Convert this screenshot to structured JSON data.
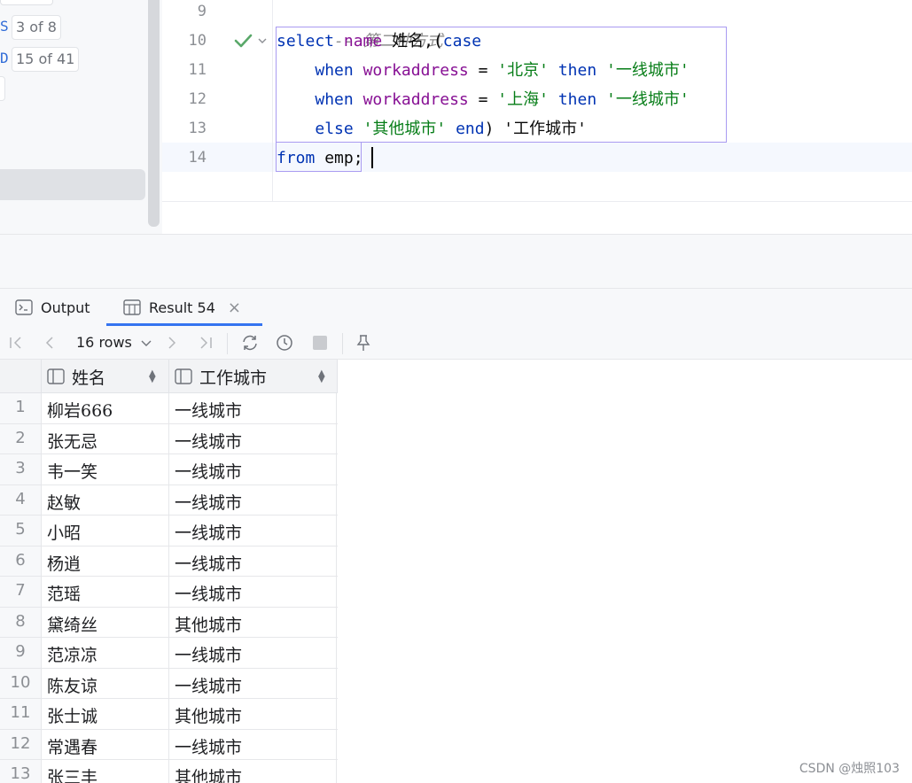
{
  "sidebar": {
    "badges": [
      "3 of 8",
      "15 of 41"
    ],
    "marks": [
      "S",
      "D"
    ]
  },
  "editor": {
    "line_numbers": [
      "9",
      "10",
      "11",
      "12",
      "13",
      "14"
    ],
    "comment": "-- 第二种方式",
    "l10": {
      "select": "select",
      "name": "name",
      "alias": "姓名,(",
      "case": "case"
    },
    "l11": {
      "indent": "    ",
      "when": "when",
      "col": "workaddress",
      "eq": " = ",
      "val": "'北京'",
      "then": "then",
      "res": "'一线城市'"
    },
    "l12": {
      "indent": "    ",
      "when": "when",
      "col": "workaddress",
      "eq": " = ",
      "val": "'上海'",
      "then": "then",
      "res": "'一线城市'"
    },
    "l13": {
      "indent": "    ",
      "else": "else",
      "val": "'其他城市'",
      "end": "end",
      "tail": ") '工作城市'"
    },
    "l14": {
      "from": "from",
      "table": " emp;"
    }
  },
  "tabs": {
    "output": "Output",
    "result": "Result 54",
    "close": "×"
  },
  "toolbar": {
    "rows": "16 rows",
    "rows_arrow": "⌄"
  },
  "grid": {
    "columns": [
      "姓名",
      "工作城市"
    ],
    "rows": [
      {
        "n": "1",
        "name": "柳岩666",
        "city": "一线城市"
      },
      {
        "n": "2",
        "name": "张无忌",
        "city": "一线城市"
      },
      {
        "n": "3",
        "name": "韦一笑",
        "city": "一线城市"
      },
      {
        "n": "4",
        "name": "赵敏",
        "city": "一线城市"
      },
      {
        "n": "5",
        "name": "小昭",
        "city": "一线城市"
      },
      {
        "n": "6",
        "name": "杨逍",
        "city": "一线城市"
      },
      {
        "n": "7",
        "name": "范瑶",
        "city": "一线城市"
      },
      {
        "n": "8",
        "name": "黛绮丝",
        "city": "其他城市"
      },
      {
        "n": "9",
        "name": "范凉凉",
        "city": "一线城市"
      },
      {
        "n": "10",
        "name": "陈友谅",
        "city": "一线城市"
      },
      {
        "n": "11",
        "name": "张士诚",
        "city": "其他城市"
      },
      {
        "n": "12",
        "name": "常遇春",
        "city": "一线城市"
      },
      {
        "n": "13",
        "name": "张三丰",
        "city": "其他城市"
      }
    ]
  },
  "watermark": "CSDN @烛照103",
  "colors": {
    "keyword": "#0033b3",
    "identifier": "#871094",
    "string": "#067d17",
    "accent": "#3574f0",
    "selection_border": "#a99bf1"
  }
}
